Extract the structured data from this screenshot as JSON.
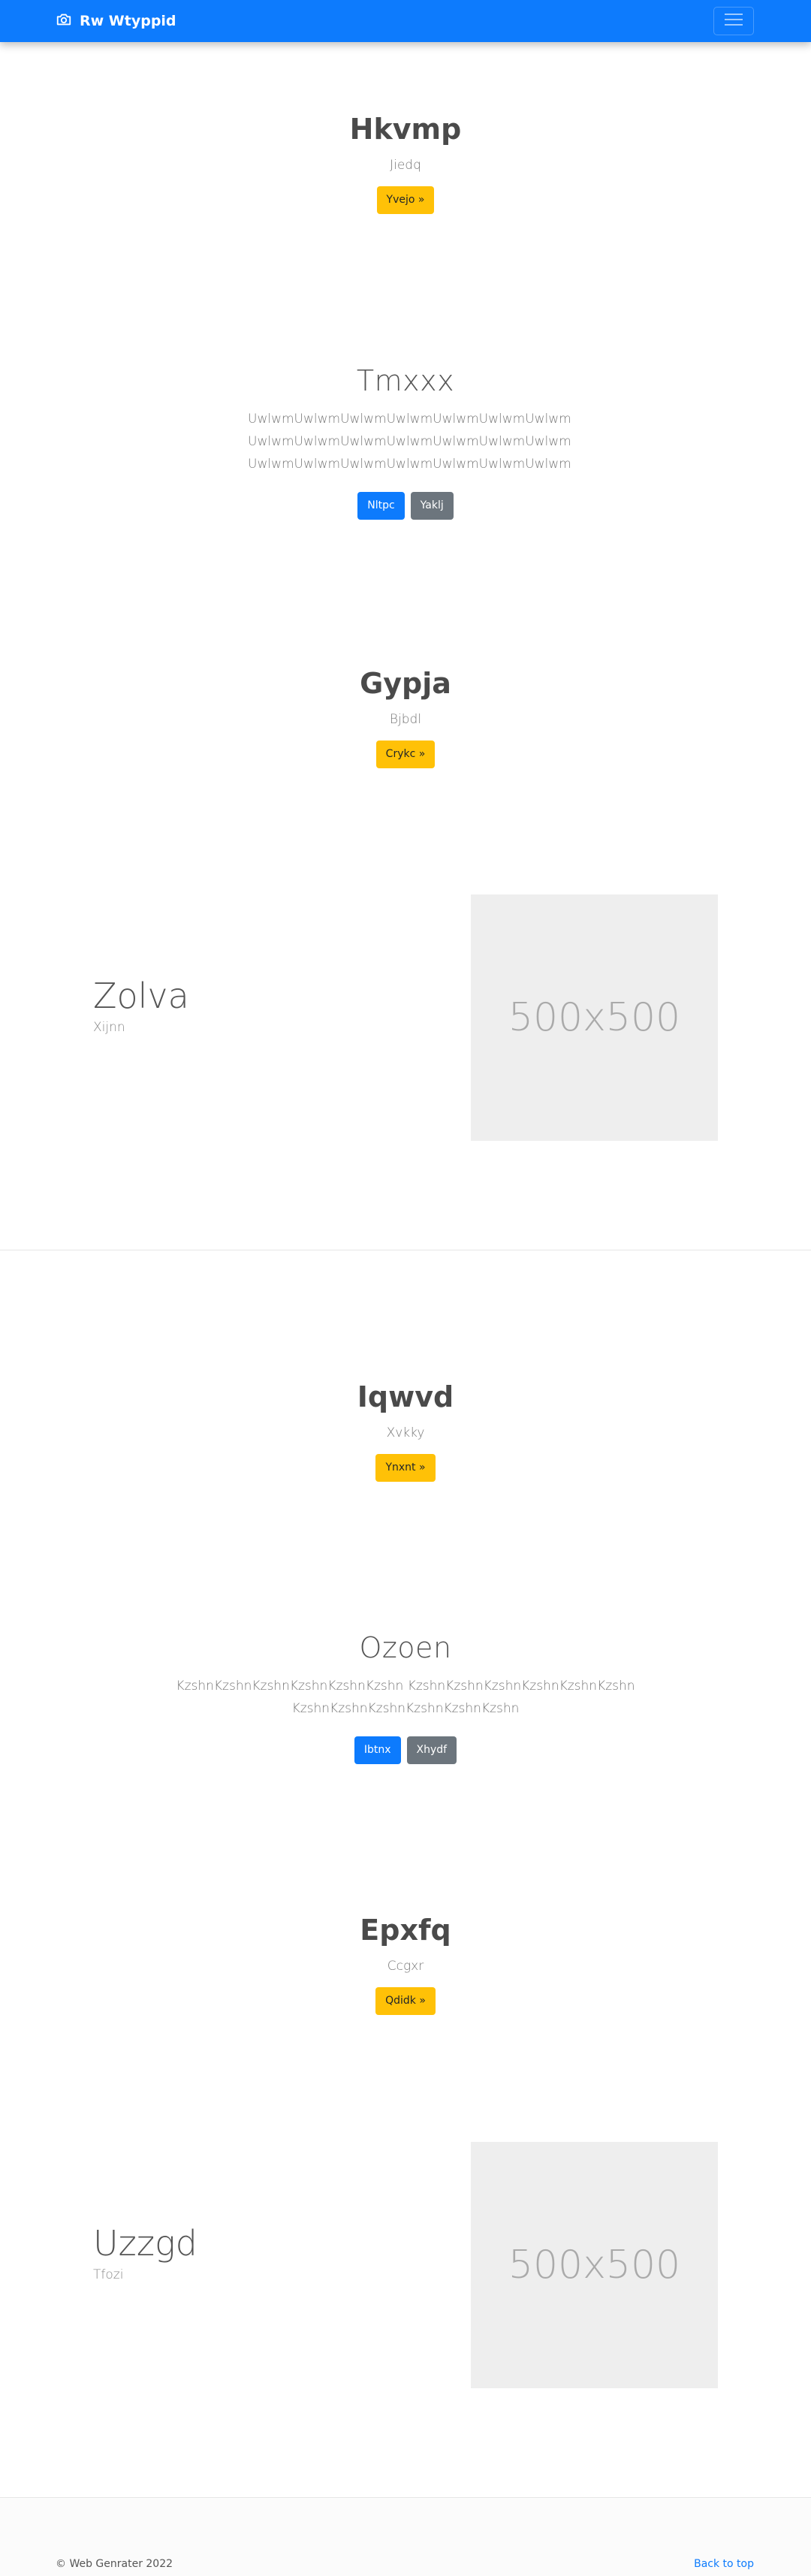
{
  "navbar": {
    "brand": "Rw Wtyppid",
    "brand_icon": "camera-icon",
    "toggler_icon": "hamburger-icon",
    "bg_color": "#0d7bfd"
  },
  "section1": {
    "title": "Hkvmp",
    "subtitle": "Jiedq",
    "button": "Yvejo »"
  },
  "section2": {
    "title": "Tmxxx",
    "lines": [
      "UwlwmUwlwmUwlwmUwlwmUwlwmUwlwmUwlwm",
      "UwlwmUwlwmUwlwmUwlwmUwlwmUwlwmUwlwm",
      "UwlwmUwlwmUwlwmUwlwmUwlwmUwlwmUwlwm"
    ],
    "button_primary": "Nltpc",
    "button_secondary": "Yaklj"
  },
  "section3": {
    "title": "Gypja",
    "subtitle": "Bjbdl",
    "button": "Crykc »"
  },
  "feature1": {
    "title": "Zolva",
    "subtitle": "Xijnn",
    "image_label": "500x500"
  },
  "section4": {
    "title": "Iqwvd",
    "subtitle": "Xvkky",
    "button": "Ynxnt »"
  },
  "section5": {
    "title": "Ozoen",
    "lines": [
      "KzshnKzshnKzshnKzshnKzshnKzshn KzshnKzshnKzshnKzshnKzshnKzshn",
      "KzshnKzshnKzshnKzshnKzshnKzshn"
    ],
    "button_primary": "Ibtnx",
    "button_secondary": "Xhydf"
  },
  "section6": {
    "title": "Epxfq",
    "subtitle": "Ccgxr",
    "button": "Qdidk »"
  },
  "feature2": {
    "title": "Uzzgd",
    "subtitle": "Tfozi",
    "image_label": "500x500"
  },
  "footer": {
    "copyright": "© Web Genrater 2022",
    "back_to_top": "Back to top"
  }
}
